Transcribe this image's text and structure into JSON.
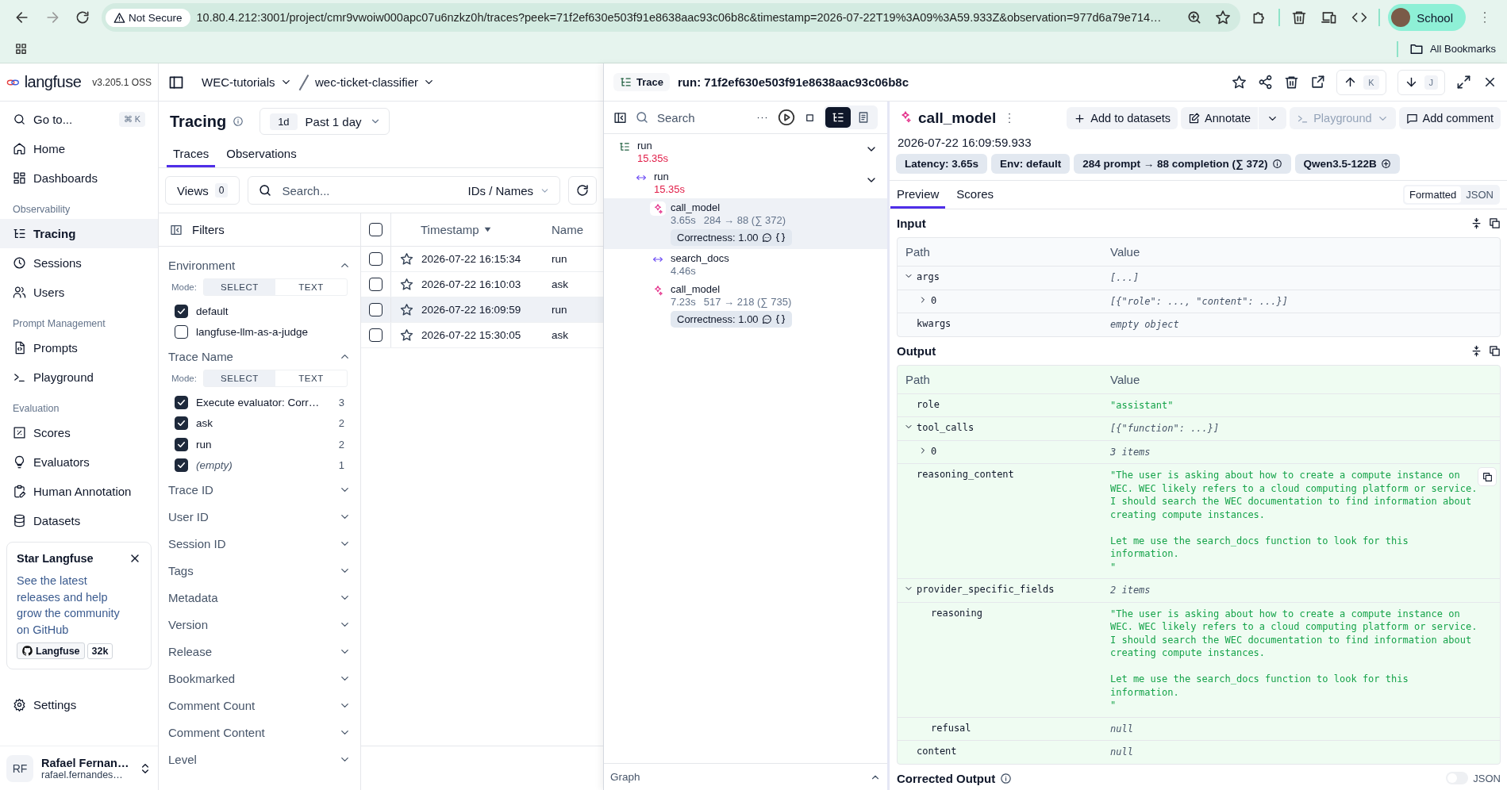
{
  "browser": {
    "security": "Not Secure",
    "url": "10.80.4.212:3001/project/cmr9vwoiw000apc07u6nzkz0h/traces?peek=71f2ef630e503f91e8638aac93c06b8c&timestamp=2026-07-22T19%3A09%3A59.933Z&observation=977d6a79e714…",
    "profile": "School",
    "bookmarks": "All Bookmarks"
  },
  "sidebar": {
    "logo": "langfuse",
    "version": "v3.205.1 OSS",
    "goto": {
      "label": "Go to...",
      "shortcut": "⌘ K"
    },
    "sections": [
      {
        "items": [
          {
            "label": "Home",
            "selected": false
          },
          {
            "label": "Dashboards",
            "selected": false
          }
        ]
      },
      {
        "title": "Observability",
        "items": [
          {
            "label": "Tracing",
            "selected": true
          },
          {
            "label": "Sessions",
            "selected": false
          },
          {
            "label": "Users",
            "selected": false
          }
        ]
      },
      {
        "title": "Prompt Management",
        "items": [
          {
            "label": "Prompts",
            "selected": false
          },
          {
            "label": "Playground",
            "selected": false
          }
        ]
      },
      {
        "title": "Evaluation",
        "items": [
          {
            "label": "Scores",
            "selected": false
          },
          {
            "label": "Evaluators",
            "selected": false
          },
          {
            "label": "Human Annotation",
            "selected": false
          },
          {
            "label": "Datasets",
            "selected": false
          }
        ]
      }
    ],
    "promo": {
      "title": "Star Langfuse",
      "text": "See the latest releases and help grow the community on GitHub",
      "button": "Langfuse",
      "count": "32k"
    },
    "settings": "Settings",
    "user": {
      "initials": "RF",
      "name": "Rafael Fernan…",
      "email": "rafael.fernandes…"
    }
  },
  "breadcrumb": [
    {
      "label": "WEC-tutorials"
    },
    {
      "label": "wec-ticket-classifier"
    }
  ],
  "page": {
    "title": "Tracing",
    "range_badge": "1d",
    "range": "Past 1 day",
    "tabs": [
      {
        "label": "Traces",
        "selected": true
      },
      {
        "label": "Observations",
        "selected": false
      }
    ],
    "views": {
      "label": "Views",
      "count": "0"
    },
    "search": {
      "placeholder": "Search...",
      "scope": "IDs / Names"
    }
  },
  "filters": {
    "title": "Filters",
    "groups": [
      {
        "label": "Environment",
        "expanded": true,
        "mode_label": "Mode:",
        "modes": [
          {
            "label": "SELECT",
            "selected": true
          },
          {
            "label": "TEXT",
            "selected": false
          }
        ],
        "options": [
          {
            "label": "default",
            "checked": true,
            "kind": "value"
          },
          {
            "label": "langfuse-llm-as-a-judge",
            "checked": false,
            "kind": "value"
          }
        ]
      },
      {
        "label": "Trace Name",
        "expanded": true,
        "mode_label": "Mode:",
        "modes": [
          {
            "label": "SELECT",
            "selected": true
          },
          {
            "label": "TEXT",
            "selected": false
          }
        ],
        "options": [
          {
            "label": "Execute evaluator: Corr…",
            "checked": true,
            "count": "3",
            "kind": "value"
          },
          {
            "label": "ask",
            "checked": true,
            "count": "2",
            "kind": "value"
          },
          {
            "label": "run",
            "checked": true,
            "count": "2",
            "kind": "value"
          },
          {
            "label": "(empty)",
            "checked": true,
            "count": "1",
            "kind": "empty"
          }
        ]
      },
      {
        "label": "Trace ID",
        "expanded": false
      },
      {
        "label": "User ID",
        "expanded": false
      },
      {
        "label": "Session ID",
        "expanded": false
      },
      {
        "label": "Tags",
        "expanded": false
      },
      {
        "label": "Metadata",
        "expanded": false
      },
      {
        "label": "Version",
        "expanded": false
      },
      {
        "label": "Release",
        "expanded": false
      },
      {
        "label": "Bookmarked",
        "expanded": false
      },
      {
        "label": "Comment Count",
        "expanded": false
      },
      {
        "label": "Comment Content",
        "expanded": false
      },
      {
        "label": "Level",
        "expanded": false
      }
    ]
  },
  "table": {
    "all_checked": false,
    "columns": [
      {
        "label": "Timestamp",
        "sorted": true
      },
      {
        "label": "Name",
        "sorted": false
      }
    ],
    "rows": [
      {
        "timestamp": "2026-07-22 16:15:34",
        "name": "run",
        "checked": false,
        "bookmarked": false,
        "selected": false
      },
      {
        "timestamp": "2026-07-22 16:10:03",
        "name": "ask",
        "checked": false,
        "bookmarked": false,
        "selected": false
      },
      {
        "timestamp": "2026-07-22 16:09:59",
        "name": "run",
        "checked": false,
        "bookmarked": false,
        "selected": true
      },
      {
        "timestamp": "2026-07-22 15:30:05",
        "name": "ask",
        "checked": false,
        "bookmarked": false,
        "selected": false
      }
    ]
  },
  "trace": {
    "badge": "Trace",
    "title": "run: 71f2ef630e503f91e8638aac93c06b8c",
    "prev_key": "K",
    "next_key": "J",
    "search_placeholder": "Search",
    "graph": "Graph",
    "tree": [
      {
        "name": "run",
        "kind": "trace",
        "duration": "15.35s",
        "slow": true,
        "selected": false,
        "expanded": true,
        "children": [
          {
            "name": "run",
            "kind": "span",
            "duration": "15.35s",
            "slow": true,
            "selected": false,
            "expanded": true,
            "children": [
              {
                "name": "call_model",
                "kind": "generation",
                "duration": "3.65s",
                "tokens": "284 → 88 (∑ 372)",
                "score": "Correctness: 1.00",
                "slow": false,
                "selected": true
              },
              {
                "name": "search_docs",
                "kind": "span",
                "duration": "4.46s",
                "slow": false,
                "selected": false
              },
              {
                "name": "call_model",
                "kind": "generation",
                "duration": "7.23s",
                "tokens": "517 → 218 (∑ 735)",
                "score": "Correctness: 1.00",
                "slow": false,
                "selected": false
              }
            ]
          }
        ]
      }
    ]
  },
  "detail": {
    "name": "call_model",
    "actions": [
      {
        "label": "Add to datasets",
        "kind": "plain",
        "disabled": false
      },
      {
        "label": "Annotate",
        "kind": "split",
        "disabled": false
      },
      {
        "label": "Playground",
        "kind": "dropdown",
        "disabled": true
      },
      {
        "label": "Add comment",
        "kind": "plain",
        "disabled": false
      }
    ],
    "timestamp": "2026-07-22 16:09:59.933",
    "badges": [
      {
        "label": "Latency: 3.65s",
        "kind": "plain"
      },
      {
        "label": "Env: default",
        "kind": "plain"
      },
      {
        "label": "284 prompt → 88 completion (∑ 372)",
        "kind": "info"
      },
      {
        "label": "Qwen3.5-122B",
        "kind": "add"
      }
    ],
    "tabs": [
      {
        "label": "Preview",
        "selected": true
      },
      {
        "label": "Scores",
        "selected": false
      }
    ],
    "view_modes": [
      {
        "label": "Formatted",
        "selected": true
      },
      {
        "label": "JSON",
        "selected": false
      }
    ],
    "input": {
      "title": "Input",
      "kind": "input",
      "columns": [
        "Path",
        "Value"
      ],
      "rows": [
        {
          "path": "args",
          "value": "[...]",
          "kind": "meta",
          "expanded": true,
          "children": [
            {
              "path": "0",
              "value": "[{\"role\": ..., \"content\": ...}]",
              "kind": "meta",
              "expanded": false
            }
          ]
        },
        {
          "path": "kwargs",
          "value": "empty object",
          "kind": "meta"
        }
      ]
    },
    "output": {
      "title": "Output",
      "kind": "output",
      "columns": [
        "Path",
        "Value"
      ],
      "rows": [
        {
          "path": "role",
          "value": "\"assistant\"",
          "kind": "string"
        },
        {
          "path": "tool_calls",
          "value": "[{\"function\": ...}]",
          "kind": "meta",
          "expanded": true,
          "children": [
            {
              "path": "0",
              "value": "3 items",
              "kind": "meta",
              "expanded": false
            }
          ]
        },
        {
          "path": "reasoning_content",
          "value": "\"The user is asking about how to create a compute instance on WEC. WEC likely refers to a cloud computing platform or service. I should search the WEC documentation to find information about creating compute instances.\n\nLet me use the search_docs function to look for this information.\n\"",
          "kind": "string",
          "copy": true
        },
        {
          "path": "provider_specific_fields",
          "value": "2 items",
          "kind": "meta",
          "expanded": true,
          "children": [
            {
              "path": "reasoning",
              "value": "\"The user is asking about how to create a compute instance on WEC. WEC likely refers to a cloud computing platform or service. I should search the WEC documentation to find information about creating compute instances.\n\nLet me use the search_docs function to look for this information.\n\"",
              "kind": "string"
            },
            {
              "path": "refusal",
              "value": "null",
              "kind": "meta"
            }
          ]
        },
        {
          "path": "content",
          "value": "null",
          "kind": "meta"
        }
      ]
    },
    "corrected": {
      "title": "Corrected Output",
      "toggle_label": "JSON",
      "on": false
    }
  }
}
